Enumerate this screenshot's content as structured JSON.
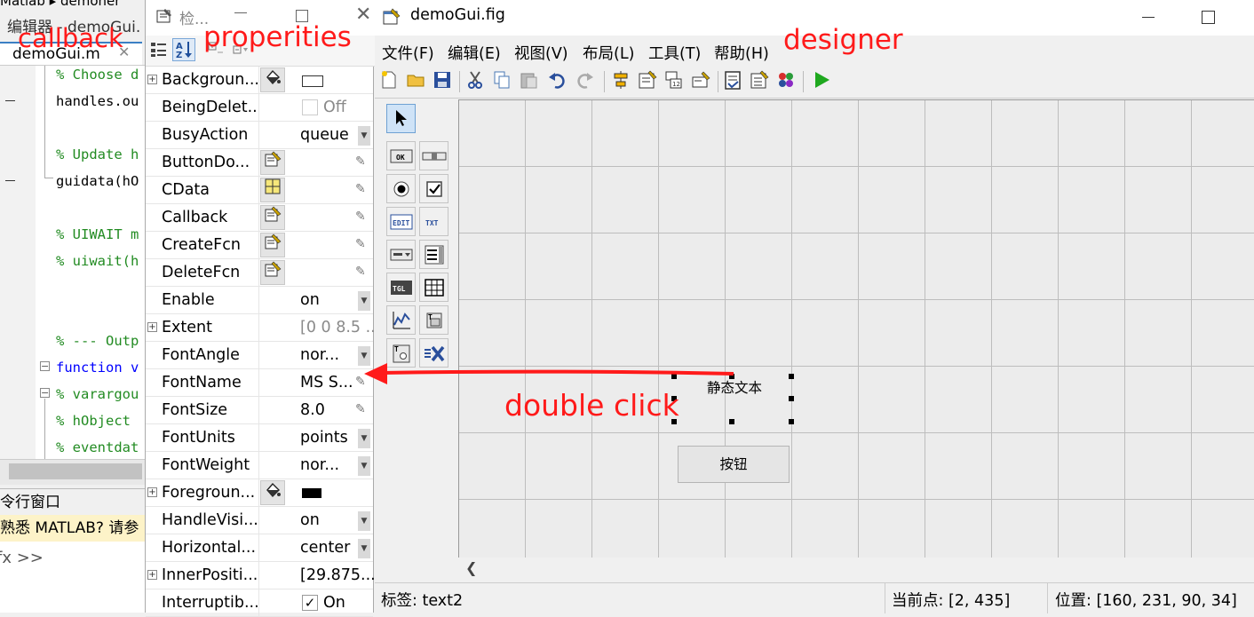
{
  "editor": {
    "path_text": "Matlab ▸ demoner",
    "title": "编辑器 - demoGui.",
    "tab_label": "demoGui.m",
    "tab_close": "✕",
    "code_lines": [
      "% Choose d",
      "handles.ou",
      "",
      "% Update h",
      "guidata(hO",
      "",
      "% UIWAIT m",
      "% uiwait(h",
      "",
      "",
      "% --- Outp",
      "function v",
      "% varargou",
      "% hObject",
      "% eventdat"
    ],
    "command_window_header": "令行窗口",
    "command_banner": "熟悉 MATLAB? 请参",
    "command_prompt": "fx >>"
  },
  "inspector": {
    "title": "检...",
    "close_glyph": "✕",
    "properties": [
      {
        "name": "Backgroun...",
        "expandable": true,
        "icon": "paint-bucket-icon",
        "value": "",
        "swatch": "white",
        "control": "none"
      },
      {
        "name": "BeingDelet...",
        "value": "Off",
        "checkbox": "unchecked-disabled",
        "grey": true,
        "control": "none"
      },
      {
        "name": "BusyAction",
        "value": "queue",
        "control": "dropdown"
      },
      {
        "name": "ButtonDo...",
        "icon": "callback-edit-icon",
        "value": "",
        "control": "pencil"
      },
      {
        "name": "CData",
        "icon": "grid-icon",
        "value": "",
        "control": "pencil"
      },
      {
        "name": "Callback",
        "icon": "callback-edit-icon",
        "value": "",
        "control": "pencil"
      },
      {
        "name": "CreateFcn",
        "icon": "callback-edit-icon",
        "value": "",
        "control": "pencil"
      },
      {
        "name": "DeleteFcn",
        "icon": "callback-edit-icon",
        "value": "",
        "control": "pencil"
      },
      {
        "name": "Enable",
        "value": "on",
        "control": "dropdown"
      },
      {
        "name": "Extent",
        "expandable": true,
        "value": "[0 0 8.5 ...",
        "grey": true,
        "control": "none"
      },
      {
        "name": "FontAngle",
        "value": "nor...",
        "control": "dropdown"
      },
      {
        "name": "FontName",
        "value": "MS S...",
        "control": "pencil"
      },
      {
        "name": "FontSize",
        "value": "8.0",
        "control": "pencil"
      },
      {
        "name": "FontUnits",
        "value": "points",
        "control": "dropdown"
      },
      {
        "name": "FontWeight",
        "value": "nor...",
        "control": "dropdown"
      },
      {
        "name": "Foregroun...",
        "expandable": true,
        "icon": "paint-bucket-icon",
        "value": "",
        "swatch": "black",
        "control": "none"
      },
      {
        "name": "HandleVisi...",
        "value": "on",
        "control": "dropdown"
      },
      {
        "name": "Horizontal...",
        "value": "center",
        "control": "dropdown"
      },
      {
        "name": "InnerPositi...",
        "expandable": true,
        "value": "[29.875...",
        "control": "none"
      },
      {
        "name": "Interruptib...",
        "value": "On",
        "checkbox": "checked",
        "control": "none"
      }
    ]
  },
  "designer": {
    "title": "demoGui.fig",
    "menus": [
      "文件(F)",
      "编辑(E)",
      "视图(V)",
      "布局(L)",
      "工具(T)",
      "帮助(H)"
    ],
    "canvas": {
      "static_text": "静态文本",
      "push_button": "按钮"
    },
    "status": {
      "tag": "标签: text2",
      "current_point": "当前点:  [2, 435]",
      "position": "位置: [160, 231, 90, 34]"
    }
  },
  "annotations": {
    "callback": "callback",
    "properities": "properities",
    "designer": "designer",
    "double_click": "double click"
  },
  "colors": {
    "annotation": "#ff1a1a",
    "comment": "#228b22",
    "keyword": "#0000ff",
    "run_green": "#1fa81f"
  }
}
